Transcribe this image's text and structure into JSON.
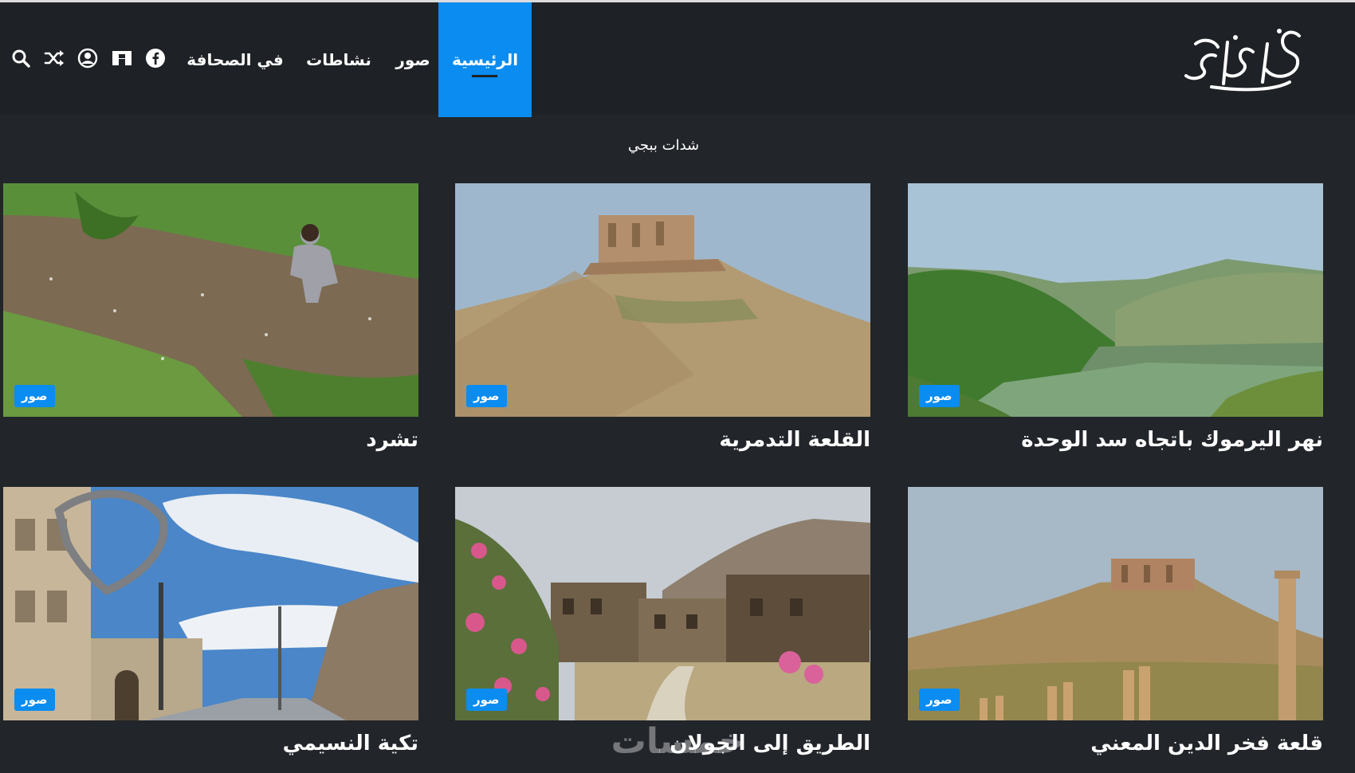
{
  "site": {
    "logo_alt": "علاء الدين"
  },
  "nav": {
    "items": [
      {
        "label": "الرئيسية",
        "active": true
      },
      {
        "label": "صور"
      },
      {
        "label": "نشاطات"
      },
      {
        "label": "في الصحافة"
      }
    ],
    "icons": [
      "facebook-icon",
      "brand-icon",
      "user-icon",
      "shuffle-icon",
      "search-icon"
    ]
  },
  "section": {
    "title": "شدات ببجي"
  },
  "badge_label": "صور",
  "cards": [
    {
      "title": "نهر اليرموك باتجاه سد الوحدة",
      "badge": "صور"
    },
    {
      "title": "القلعة التدمرية",
      "badge": "صور"
    },
    {
      "title": "تشرد",
      "badge": "صور"
    },
    {
      "title": "قلعة فخر الدين المعني",
      "badge": "صور"
    },
    {
      "title": "الطريق إلى الجولان",
      "badge": "صور"
    },
    {
      "title": "تكية النسيمي",
      "badge": "صور"
    }
  ],
  "watermark": "خمسات",
  "colors": {
    "accent": "#0a8cf0",
    "header_bg": "#1e2125",
    "page_bg": "#22252a"
  }
}
